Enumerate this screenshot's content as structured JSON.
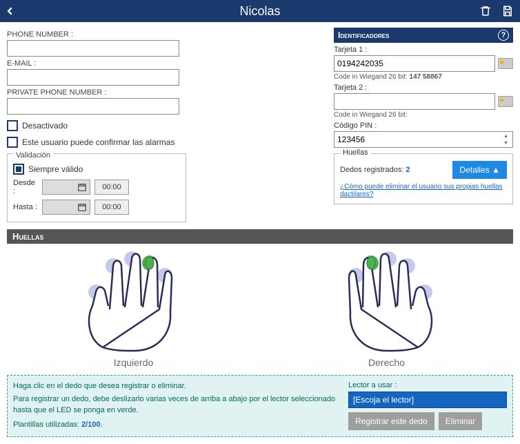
{
  "header": {
    "title": "Nicolas"
  },
  "left": {
    "phone_label": "PHONE NUMBER :",
    "phone_value": "",
    "email_label": "E-MAIL :",
    "email_value": "",
    "private_phone_label": "PRIVATE PHONE NUMBER :",
    "private_phone_value": "",
    "deactivated_label": "Desactivado",
    "confirm_alarms_label": "Este usuario puede confirmar las alarmas",
    "validation": {
      "legend": "Validación",
      "always_valid_label": "Siempre válido",
      "from_label": "Desde :",
      "to_label": "Hasta :",
      "from_date": "",
      "from_time": "00:00",
      "to_date": "",
      "to_time": "00:00"
    }
  },
  "ident": {
    "header": "Identificadores",
    "tarjeta1_label": "Tarjeta 1 :",
    "tarjeta1_value": "0194242035",
    "tarjeta1_hint_prefix": "Code in Wiegand 26 bit: ",
    "tarjeta1_hint_value": "147 58867",
    "tarjeta2_label": "Tarjeta 2 :",
    "tarjeta2_value": "",
    "tarjeta2_hint": "Code in Wiegand 26 bit:",
    "pin_label": "Código PIN :",
    "pin_value": "123456",
    "huellas": {
      "legend": "Huellas",
      "dedos_label": "Dedos registrados: ",
      "dedos_count": "2",
      "detalles_btn": "Detalles ▲",
      "link": "¿Cómo puede eliminar el usuario sus propias huellas dactilares?"
    }
  },
  "section": {
    "title": "Huellas"
  },
  "hands": {
    "left_label": "Izquierdo",
    "right_label": "Derecho"
  },
  "instructions": {
    "line1": "Haga clic en el dedo que desea registrar o eliminar.",
    "line2": "Para registrar un dedo, debe deslizarlo varias veces de arriba a abajo por el lector seleccionado hasta que el LED se ponga en verde.",
    "plantillas_label": "Plantillas utilizadas: ",
    "plantillas_value": "2/100",
    "reader_label": "Lector a usar :",
    "reader_placeholder": "[Escoja el lector]",
    "register_btn": "Registrar este dedo",
    "delete_btn": "Eliminar"
  }
}
